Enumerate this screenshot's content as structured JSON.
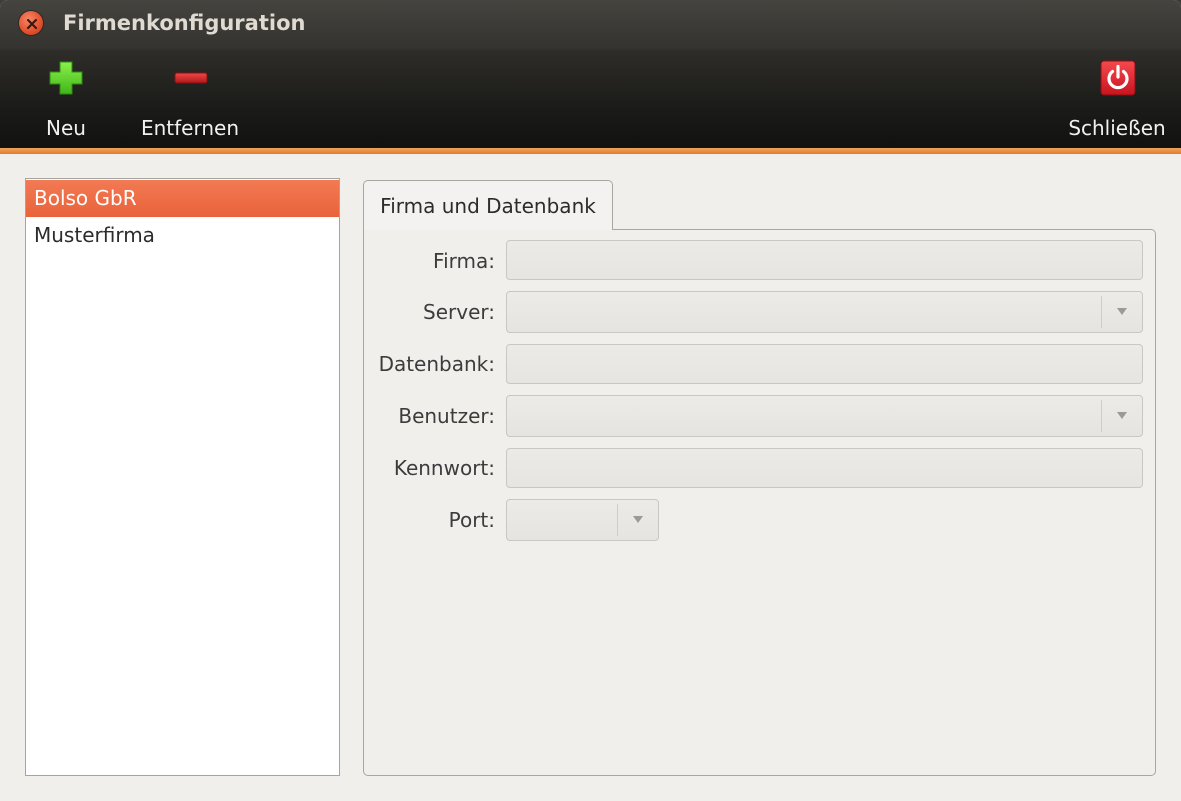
{
  "window": {
    "title": "Firmenkonfiguration"
  },
  "toolbar": {
    "new_label": "Neu",
    "remove_label": "Entfernen",
    "close_label": "Schließen"
  },
  "companies": {
    "items": [
      {
        "label": "Bolso GbR",
        "selected": true
      },
      {
        "label": "Musterfirma",
        "selected": false
      }
    ]
  },
  "tab": {
    "label": "Firma und Datenbank"
  },
  "form": {
    "firma_label": "Firma:",
    "firma_value": "",
    "server_label": "Server:",
    "server_value": "",
    "datenbank_label": "Datenbank:",
    "datenbank_value": "",
    "benutzer_label": "Benutzer:",
    "benutzer_value": "",
    "kennwort_label": "Kennwort:",
    "kennwort_value": "",
    "port_label": "Port:",
    "port_value": ""
  },
  "colors": {
    "accent": "#e9623a",
    "toolbar_underline": "#e47a30",
    "new_icon": "#5fd62a",
    "remove_icon": "#d22b2b",
    "close_icon": "#e8242f"
  },
  "icons": {
    "window_close": "close-icon",
    "new": "plus-icon",
    "remove": "minus-icon",
    "close": "power-icon",
    "combo_arrow": "chevron-down-icon"
  }
}
